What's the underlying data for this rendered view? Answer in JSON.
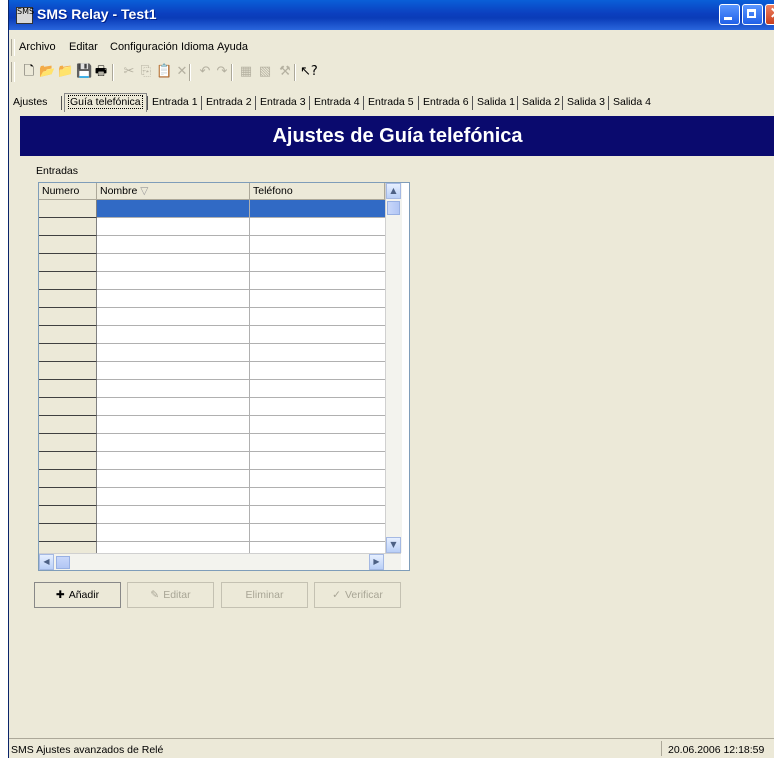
{
  "window": {
    "title": "SMS Relay - Test1",
    "app_icon_text": "SMS"
  },
  "menu": [
    "Archivo",
    "Editar",
    "Configuración",
    "Idioma",
    "Ayuda"
  ],
  "toolbar": [
    {
      "icon": "new-file-icon",
      "glyph": "🗋"
    },
    {
      "icon": "open-folder-icon",
      "glyph": "📂"
    },
    {
      "icon": "open-red-folder-icon",
      "glyph": "📁"
    },
    {
      "icon": "save-icon",
      "glyph": "💾"
    },
    {
      "icon": "print-icon",
      "glyph": "🖶"
    },
    {
      "icon": "cut-icon",
      "glyph": "✂",
      "disabled": true
    },
    {
      "icon": "copy-icon",
      "glyph": "⎘",
      "disabled": true
    },
    {
      "icon": "paste-icon",
      "glyph": "📋",
      "disabled": true
    },
    {
      "icon": "delete-icon",
      "glyph": "✕",
      "disabled": true
    },
    {
      "icon": "undo-icon",
      "glyph": "↶",
      "disabled": true
    },
    {
      "icon": "redo-icon",
      "glyph": "↷",
      "disabled": true
    },
    {
      "icon": "import-icon",
      "glyph": "▦",
      "disabled": true
    },
    {
      "icon": "export-icon",
      "glyph": "▧",
      "disabled": true
    },
    {
      "icon": "tools-icon",
      "glyph": "⚒",
      "disabled": true
    },
    {
      "icon": "help-pointer-icon",
      "glyph": "↖?"
    }
  ],
  "tabs": [
    "Ajustes",
    "Guía telefónica",
    "Entrada 1",
    "Entrada 2",
    "Entrada 3",
    "Entrada 4",
    "Entrada 5",
    "Entrada 6",
    "Salida 1",
    "Salida 2",
    "Salida 3",
    "Salida 4"
  ],
  "selected_tab": "Guía telefónica",
  "banner": {
    "title": "Ajustes de Guía telefónica"
  },
  "entries": {
    "label": "Entradas",
    "columns": [
      "Numero",
      "Nombre",
      "Teléfono"
    ],
    "sort_indicator": "▽",
    "row_count": 20
  },
  "buttons": [
    {
      "label": "Añadir",
      "icon": "plus-icon",
      "glyph": "✚",
      "enabled": true
    },
    {
      "label": "Editar",
      "icon": "edit-icon",
      "glyph": "✎",
      "enabled": false
    },
    {
      "label": "Eliminar",
      "icon": "",
      "glyph": "",
      "enabled": false
    },
    {
      "label": "Verificar",
      "icon": "check-icon",
      "glyph": "✓",
      "enabled": false
    }
  ],
  "status": {
    "message": "SMS Ajustes avanzados de Relé",
    "datetime": "20.06.2006 12:18:59"
  }
}
